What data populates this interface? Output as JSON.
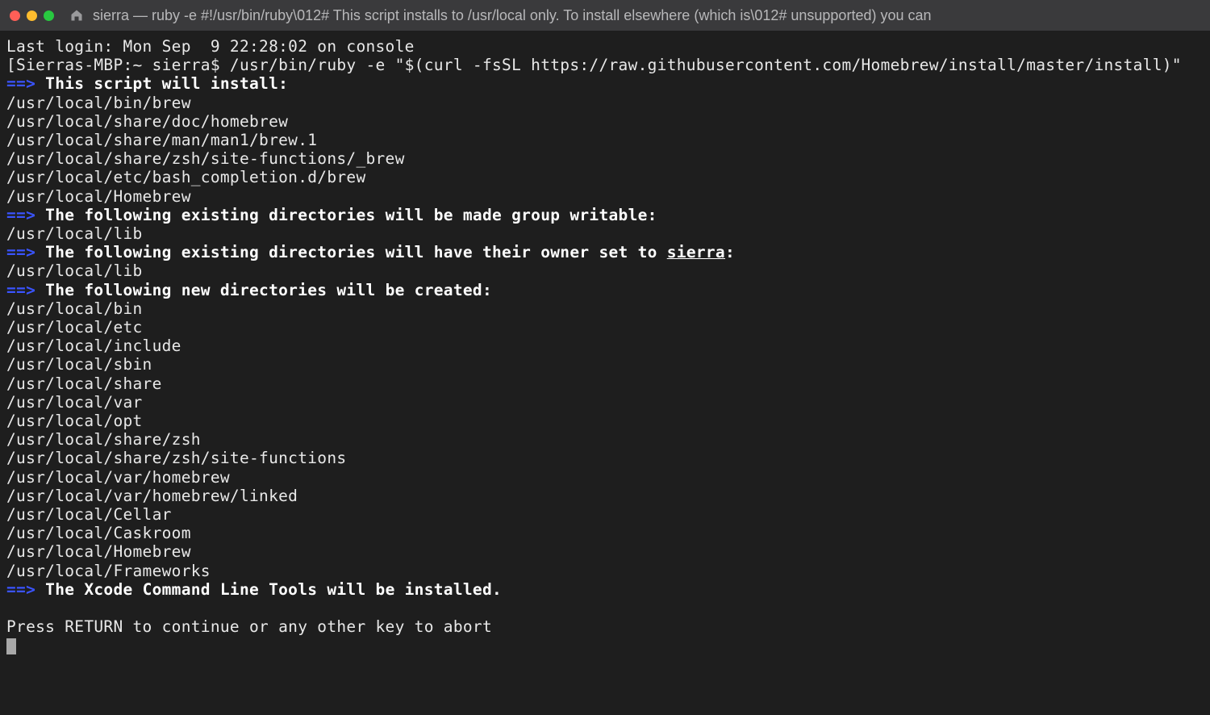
{
  "titlebar": {
    "title": "sierra — ruby -e #!/usr/bin/ruby\\012# This script installs to /usr/local only. To install elsewhere (which is\\012# unsupported) you can"
  },
  "terminal": {
    "last_login": "Last login: Mon Sep  9 22:28:02 on console",
    "prompt_host": "[Sierras-MBP:~ sierra$ ",
    "command": "/usr/bin/ruby -e \"$(curl -fsSL https://raw.githubusercontent.com/Homebrew/install/master/install)\"",
    "arrow": "==>",
    "section1_title": " This script will install:",
    "install_paths": [
      "/usr/local/bin/brew",
      "/usr/local/share/doc/homebrew",
      "/usr/local/share/man/man1/brew.1",
      "/usr/local/share/zsh/site-functions/_brew",
      "/usr/local/etc/bash_completion.d/brew",
      "/usr/local/Homebrew"
    ],
    "section2_title": " The following existing directories will be made group writable:",
    "writable_paths": [
      "/usr/local/lib"
    ],
    "section3_prefix": " The following existing directories will have their owner set to ",
    "section3_user": "sierra",
    "section3_suffix": ":",
    "owner_paths": [
      "/usr/local/lib"
    ],
    "section4_title": " The following new directories will be created:",
    "new_dirs": [
      "/usr/local/bin",
      "/usr/local/etc",
      "/usr/local/include",
      "/usr/local/sbin",
      "/usr/local/share",
      "/usr/local/var",
      "/usr/local/opt",
      "/usr/local/share/zsh",
      "/usr/local/share/zsh/site-functions",
      "/usr/local/var/homebrew",
      "/usr/local/var/homebrew/linked",
      "/usr/local/Cellar",
      "/usr/local/Caskroom",
      "/usr/local/Homebrew",
      "/usr/local/Frameworks"
    ],
    "section5_title": " The Xcode Command Line Tools will be installed.",
    "prompt_text": "Press RETURN to continue or any other key to abort"
  }
}
